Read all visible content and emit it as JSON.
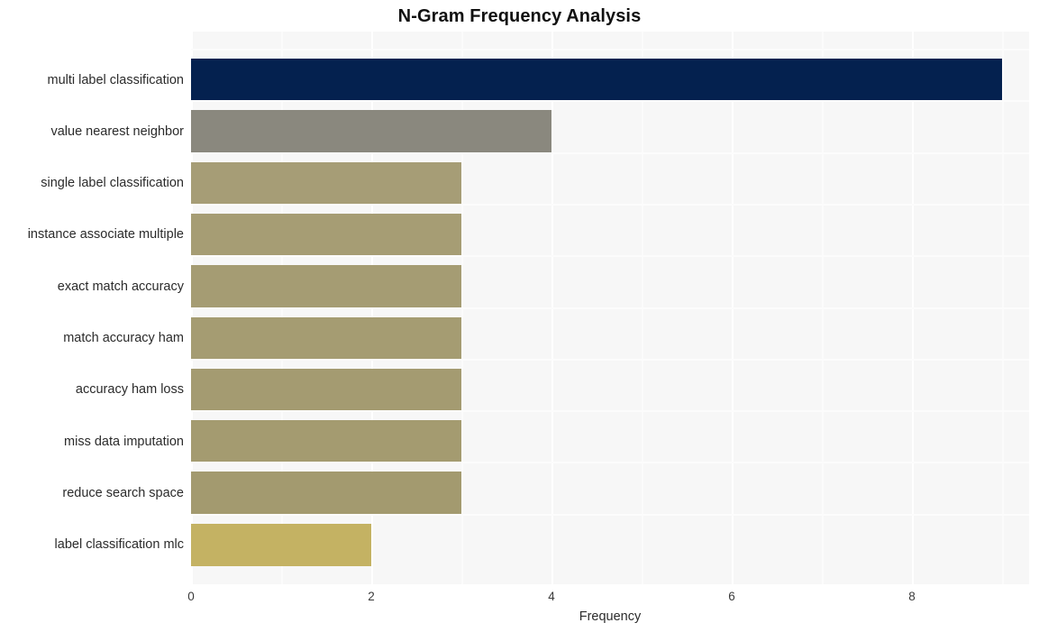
{
  "chart_data": {
    "type": "bar",
    "orientation": "horizontal",
    "title": "N-Gram Frequency Analysis",
    "xlabel": "Frequency",
    "ylabel": "",
    "xlim": [
      0,
      9.3
    ],
    "xticks": [
      0,
      2,
      4,
      6,
      8
    ],
    "xticklabels": [
      "0",
      "2",
      "4",
      "6",
      "8"
    ],
    "grid": true,
    "grid_color": "#ffffff",
    "plot_background": "#f7f7f7",
    "legend": false,
    "categories": [
      "multi label classification",
      "value nearest neighbor",
      "single label classification",
      "instance associate multiple",
      "exact match accuracy",
      "match accuracy ham",
      "accuracy ham loss",
      "miss data imputation",
      "reduce search space",
      "label classification mlc"
    ],
    "values": [
      9,
      4,
      3,
      3,
      3,
      3,
      3,
      3,
      3,
      2
    ],
    "bar_colors": [
      "#04214f",
      "#8a887e",
      "#a69d76",
      "#a69d74",
      "#a59c73",
      "#a59c72",
      "#a49b71",
      "#a49b70",
      "#a39a6f",
      "#c4b263"
    ]
  }
}
